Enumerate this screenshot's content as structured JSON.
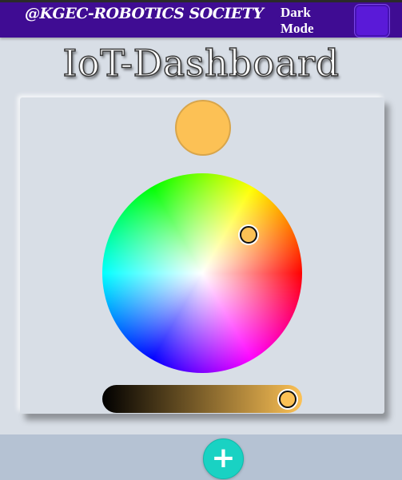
{
  "header": {
    "brand": "@KGEC-ROBOTICS SOCIETY",
    "dark_mode_label": "Dark Mode"
  },
  "page": {
    "title": "IoT-Dashboard"
  },
  "color_picker": {
    "selected_color": "#fcc155",
    "brightness_slider_gradient": [
      "#000000",
      "#fcc155"
    ]
  },
  "fab": {
    "icon": "plus-icon",
    "symbol": "+"
  }
}
